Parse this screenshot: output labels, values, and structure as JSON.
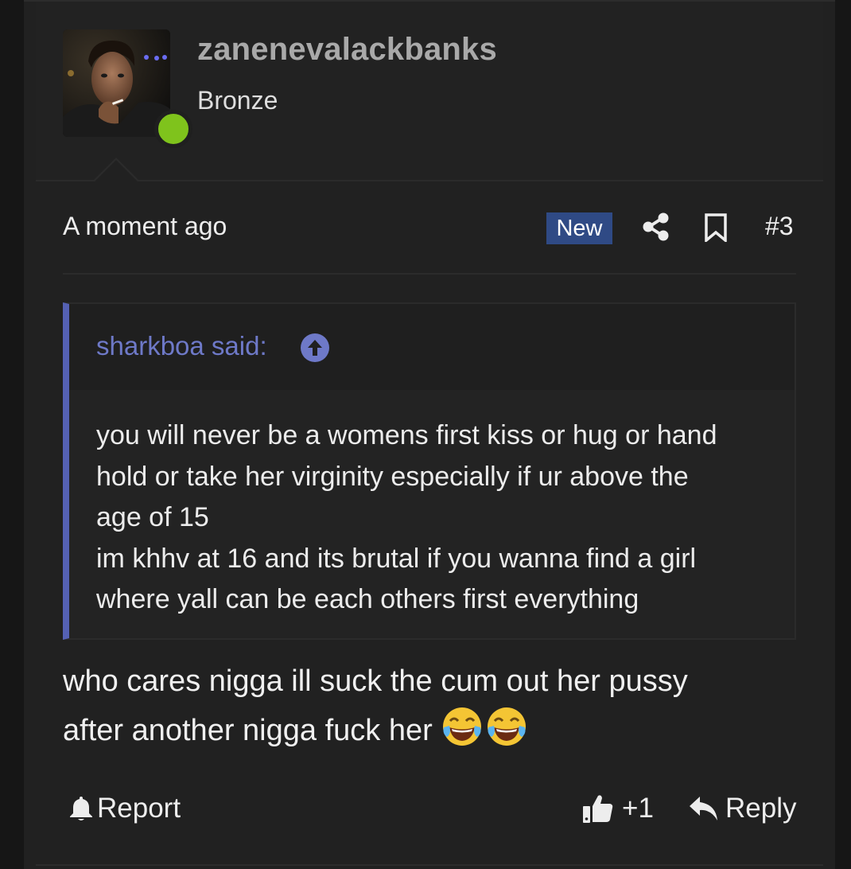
{
  "user": {
    "username": "zanenevalackbanks",
    "title": "Bronze",
    "avatar_icon": "user-avatar-photo",
    "online_status": "online",
    "online_color": "#7fc31c"
  },
  "meta": {
    "timestamp": "A moment ago",
    "badge": "New",
    "badge_color": "#2f4a85",
    "share_icon": "share-icon",
    "bookmark_icon": "bookmark-icon",
    "post_number": "#3"
  },
  "quote": {
    "author_line": "sharkboa said:",
    "jump_icon": "arrow-up-circle-icon",
    "accent_color": "#5561b4",
    "lines": [
      "you will never be a womens first kiss or hug or hand",
      "hold or take her virginity especially if ur above the",
      "age of 15",
      "im khhv at 16 and its brutal if you wanna find a girl",
      "where yall can be each others first everything"
    ]
  },
  "message": {
    "lines": [
      "who cares nigga ill suck the cum out her pussy",
      "after another nigga fuck her "
    ],
    "emoji": [
      "face-with-tears-of-joy",
      "face-with-tears-of-joy"
    ]
  },
  "actions": {
    "report_label": "Report",
    "report_icon": "bell-icon",
    "like_count": "+1",
    "like_icon": "thumbs-up-icon",
    "reply_label": "Reply",
    "reply_icon": "reply-arrow-icon"
  }
}
